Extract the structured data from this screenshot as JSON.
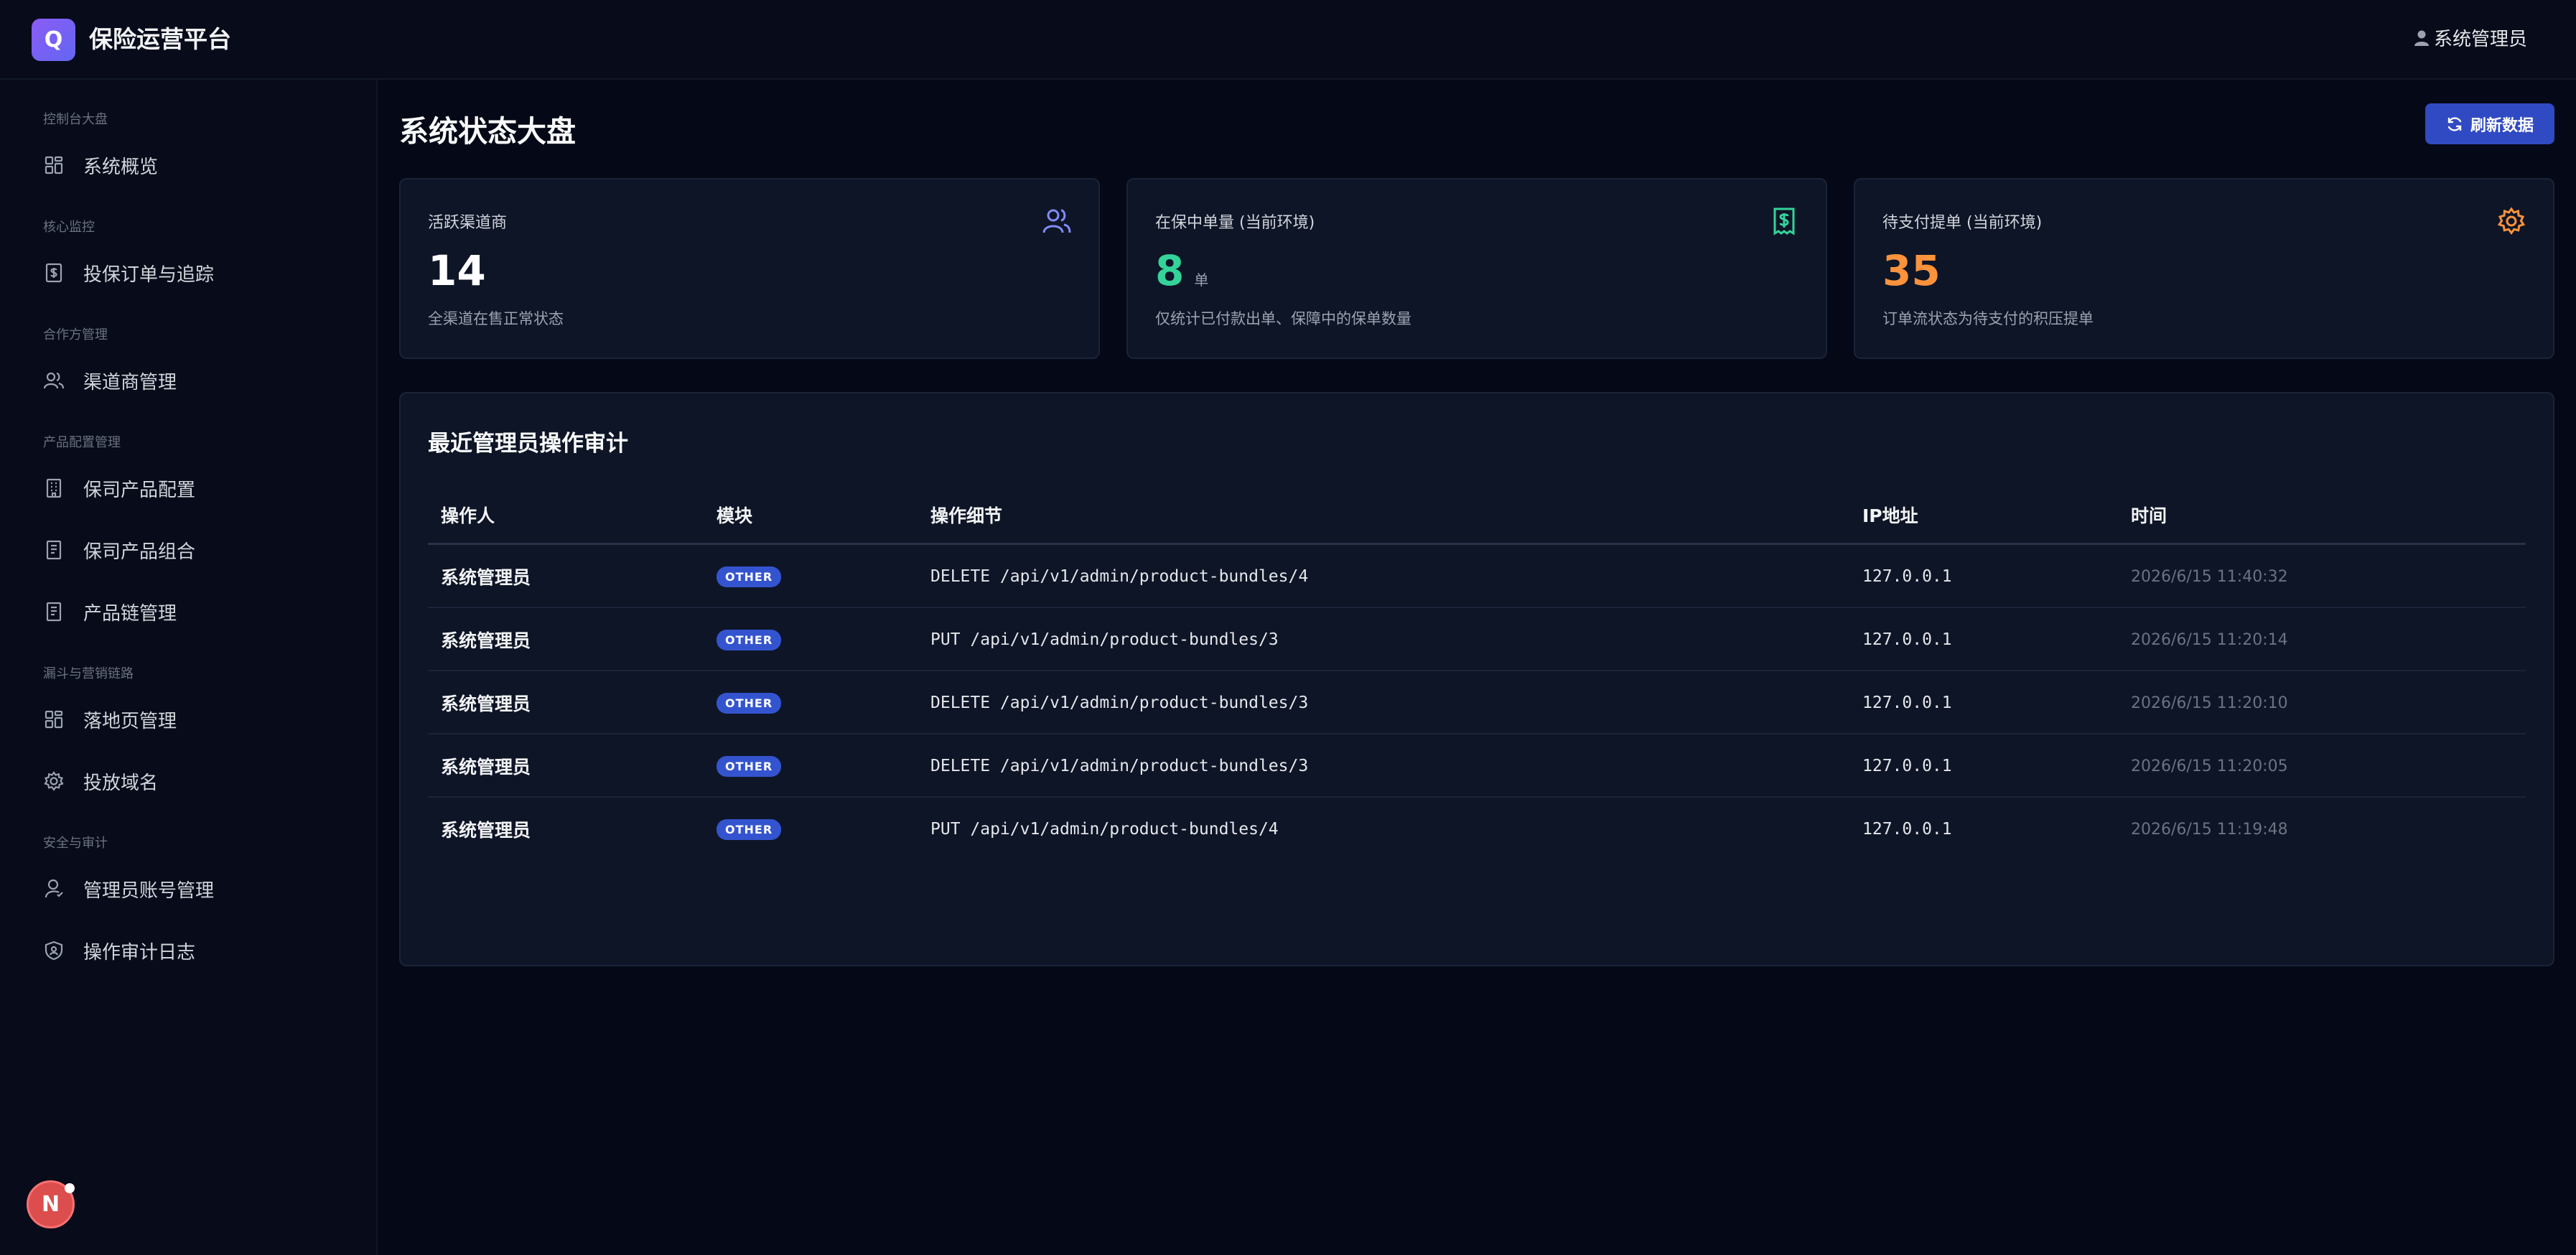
{
  "app": {
    "logo_letter": "Q",
    "title": "保险运营平台",
    "user_name": "系统管理员"
  },
  "sidebar": {
    "groups": [
      {
        "label": "控制台大盘",
        "items": [
          {
            "label": "系统概览",
            "icon": "grid-icon"
          }
        ]
      },
      {
        "label": "核心监控",
        "items": [
          {
            "label": "投保订单与追踪",
            "icon": "receipt-icon"
          }
        ]
      },
      {
        "label": "合作方管理",
        "items": [
          {
            "label": "渠道商管理",
            "icon": "users-icon"
          }
        ]
      },
      {
        "label": "产品配置管理",
        "items": [
          {
            "label": "保司产品配置",
            "icon": "building-icon"
          },
          {
            "label": "保司产品组合",
            "icon": "document-icon"
          },
          {
            "label": "产品链管理",
            "icon": "document-icon"
          }
        ]
      },
      {
        "label": "漏斗与营销链路",
        "items": [
          {
            "label": "落地页管理",
            "icon": "grid-icon"
          },
          {
            "label": "投放域名",
            "icon": "gear-icon"
          }
        ]
      },
      {
        "label": "安全与审计",
        "items": [
          {
            "label": "管理员账号管理",
            "icon": "user-icon"
          },
          {
            "label": "操作审计日志",
            "icon": "shield-icon"
          }
        ]
      }
    ]
  },
  "main": {
    "page_title": "系统状态大盘",
    "refresh_label": "刷新数据",
    "stats": [
      {
        "label": "活跃渠道商",
        "value": "14",
        "unit": "",
        "desc": "全渠道在售正常状态",
        "color": "#ffffff",
        "icon": "users-icon",
        "icon_color": "#818cf8"
      },
      {
        "label": "在保中单量 (当前环境)",
        "value": "8",
        "unit": "单",
        "desc": "仅统计已付款出单、保障中的保单数量",
        "color": "#34d399",
        "icon": "receipt-icon",
        "icon_color": "#34d399"
      },
      {
        "label": "待支付提单 (当前环境)",
        "value": "35",
        "unit": "",
        "desc": "订单流状态为待支付的积压提单",
        "color": "#fb923c",
        "icon": "gear-icon",
        "icon_color": "#fb923c"
      }
    ],
    "audit": {
      "title": "最近管理员操作审计",
      "columns": [
        "操作人",
        "模块",
        "操作细节",
        "IP地址",
        "时间"
      ],
      "rows": [
        {
          "operator": "系统管理员",
          "module": "OTHER",
          "detail": "DELETE /api/v1/admin/product-bundles/4",
          "ip": "127.0.0.1",
          "time": "2026/6/15 11:40:32"
        },
        {
          "operator": "系统管理员",
          "module": "OTHER",
          "detail": "PUT /api/v1/admin/product-bundles/3",
          "ip": "127.0.0.1",
          "time": "2026/6/15 11:20:14"
        },
        {
          "operator": "系统管理员",
          "module": "OTHER",
          "detail": "DELETE /api/v1/admin/product-bundles/3",
          "ip": "127.0.0.1",
          "time": "2026/6/15 11:20:10"
        },
        {
          "operator": "系统管理员",
          "module": "OTHER",
          "detail": "DELETE /api/v1/admin/product-bundles/3",
          "ip": "127.0.0.1",
          "time": "2026/6/15 11:20:05"
        },
        {
          "operator": "系统管理员",
          "module": "OTHER",
          "detail": "PUT /api/v1/admin/product-bundles/4",
          "ip": "127.0.0.1",
          "time": "2026/6/15 11:19:48"
        }
      ]
    }
  },
  "dev_badge": {
    "letter": "N"
  }
}
